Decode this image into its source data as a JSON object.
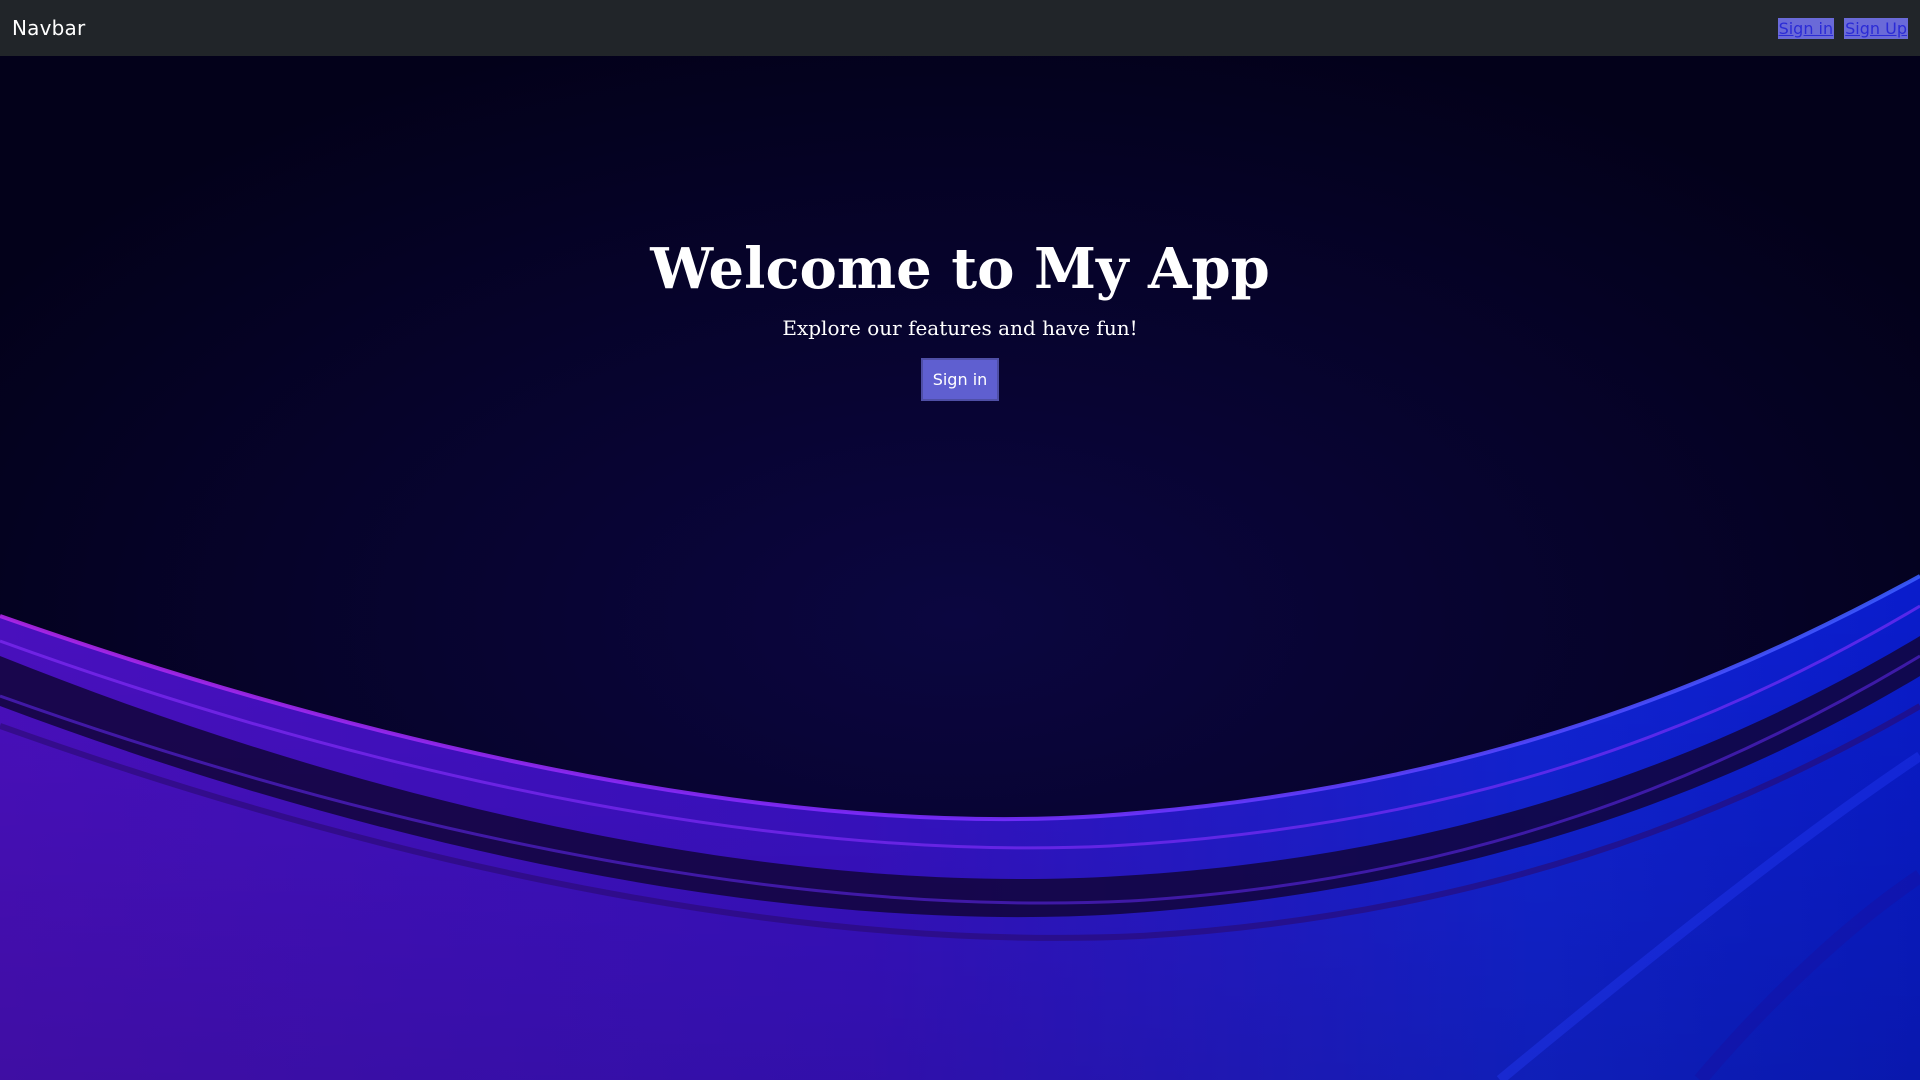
{
  "navbar": {
    "brand": "Navbar",
    "links": [
      {
        "label": "Sign in"
      },
      {
        "label": "Sign Up"
      }
    ]
  },
  "hero": {
    "title": "Welcome to My App",
    "subtitle": "Explore our features and have fun!",
    "button_label": "Sign in"
  },
  "colors": {
    "navbar_bg": "#212529",
    "background_dark": "#040220",
    "wave_purple": "#4a10c8",
    "wave_blue": "#0a22d8",
    "button_bg": "#5f5fd0"
  }
}
